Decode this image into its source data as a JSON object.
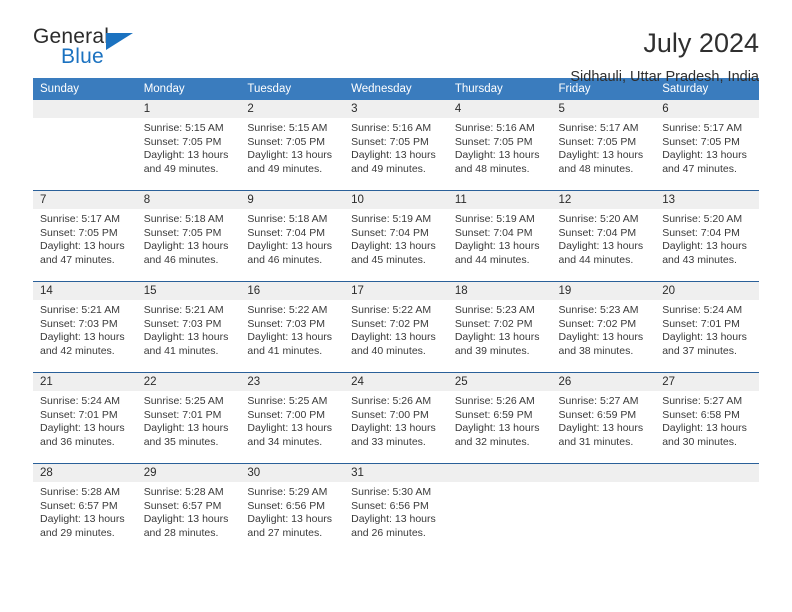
{
  "brand": {
    "name_top": "General",
    "name_bottom": "Blue",
    "accent_color": "#1b72c0"
  },
  "header": {
    "title": "July 2024",
    "subtitle": "Sidhauli, Uttar Pradesh, India"
  },
  "theme": {
    "header_row_bg": "#3a7cbe",
    "daynum_bg": "#efefef",
    "week_separator": "#2a6099",
    "text": "#2b2b2b"
  },
  "weekday_headers": [
    "Sunday",
    "Monday",
    "Tuesday",
    "Wednesday",
    "Thursday",
    "Friday",
    "Saturday"
  ],
  "weeks": [
    [
      {
        "day": "",
        "lines": []
      },
      {
        "day": "1",
        "lines": [
          "Sunrise: 5:15 AM",
          "Sunset: 7:05 PM",
          "Daylight: 13 hours",
          "and 49 minutes."
        ]
      },
      {
        "day": "2",
        "lines": [
          "Sunrise: 5:15 AM",
          "Sunset: 7:05 PM",
          "Daylight: 13 hours",
          "and 49 minutes."
        ]
      },
      {
        "day": "3",
        "lines": [
          "Sunrise: 5:16 AM",
          "Sunset: 7:05 PM",
          "Daylight: 13 hours",
          "and 49 minutes."
        ]
      },
      {
        "day": "4",
        "lines": [
          "Sunrise: 5:16 AM",
          "Sunset: 7:05 PM",
          "Daylight: 13 hours",
          "and 48 minutes."
        ]
      },
      {
        "day": "5",
        "lines": [
          "Sunrise: 5:17 AM",
          "Sunset: 7:05 PM",
          "Daylight: 13 hours",
          "and 48 minutes."
        ]
      },
      {
        "day": "6",
        "lines": [
          "Sunrise: 5:17 AM",
          "Sunset: 7:05 PM",
          "Daylight: 13 hours",
          "and 47 minutes."
        ]
      }
    ],
    [
      {
        "day": "7",
        "lines": [
          "Sunrise: 5:17 AM",
          "Sunset: 7:05 PM",
          "Daylight: 13 hours",
          "and 47 minutes."
        ]
      },
      {
        "day": "8",
        "lines": [
          "Sunrise: 5:18 AM",
          "Sunset: 7:05 PM",
          "Daylight: 13 hours",
          "and 46 minutes."
        ]
      },
      {
        "day": "9",
        "lines": [
          "Sunrise: 5:18 AM",
          "Sunset: 7:04 PM",
          "Daylight: 13 hours",
          "and 46 minutes."
        ]
      },
      {
        "day": "10",
        "lines": [
          "Sunrise: 5:19 AM",
          "Sunset: 7:04 PM",
          "Daylight: 13 hours",
          "and 45 minutes."
        ]
      },
      {
        "day": "11",
        "lines": [
          "Sunrise: 5:19 AM",
          "Sunset: 7:04 PM",
          "Daylight: 13 hours",
          "and 44 minutes."
        ]
      },
      {
        "day": "12",
        "lines": [
          "Sunrise: 5:20 AM",
          "Sunset: 7:04 PM",
          "Daylight: 13 hours",
          "and 44 minutes."
        ]
      },
      {
        "day": "13",
        "lines": [
          "Sunrise: 5:20 AM",
          "Sunset: 7:04 PM",
          "Daylight: 13 hours",
          "and 43 minutes."
        ]
      }
    ],
    [
      {
        "day": "14",
        "lines": [
          "Sunrise: 5:21 AM",
          "Sunset: 7:03 PM",
          "Daylight: 13 hours",
          "and 42 minutes."
        ]
      },
      {
        "day": "15",
        "lines": [
          "Sunrise: 5:21 AM",
          "Sunset: 7:03 PM",
          "Daylight: 13 hours",
          "and 41 minutes."
        ]
      },
      {
        "day": "16",
        "lines": [
          "Sunrise: 5:22 AM",
          "Sunset: 7:03 PM",
          "Daylight: 13 hours",
          "and 41 minutes."
        ]
      },
      {
        "day": "17",
        "lines": [
          "Sunrise: 5:22 AM",
          "Sunset: 7:02 PM",
          "Daylight: 13 hours",
          "and 40 minutes."
        ]
      },
      {
        "day": "18",
        "lines": [
          "Sunrise: 5:23 AM",
          "Sunset: 7:02 PM",
          "Daylight: 13 hours",
          "and 39 minutes."
        ]
      },
      {
        "day": "19",
        "lines": [
          "Sunrise: 5:23 AM",
          "Sunset: 7:02 PM",
          "Daylight: 13 hours",
          "and 38 minutes."
        ]
      },
      {
        "day": "20",
        "lines": [
          "Sunrise: 5:24 AM",
          "Sunset: 7:01 PM",
          "Daylight: 13 hours",
          "and 37 minutes."
        ]
      }
    ],
    [
      {
        "day": "21",
        "lines": [
          "Sunrise: 5:24 AM",
          "Sunset: 7:01 PM",
          "Daylight: 13 hours",
          "and 36 minutes."
        ]
      },
      {
        "day": "22",
        "lines": [
          "Sunrise: 5:25 AM",
          "Sunset: 7:01 PM",
          "Daylight: 13 hours",
          "and 35 minutes."
        ]
      },
      {
        "day": "23",
        "lines": [
          "Sunrise: 5:25 AM",
          "Sunset: 7:00 PM",
          "Daylight: 13 hours",
          "and 34 minutes."
        ]
      },
      {
        "day": "24",
        "lines": [
          "Sunrise: 5:26 AM",
          "Sunset: 7:00 PM",
          "Daylight: 13 hours",
          "and 33 minutes."
        ]
      },
      {
        "day": "25",
        "lines": [
          "Sunrise: 5:26 AM",
          "Sunset: 6:59 PM",
          "Daylight: 13 hours",
          "and 32 minutes."
        ]
      },
      {
        "day": "26",
        "lines": [
          "Sunrise: 5:27 AM",
          "Sunset: 6:59 PM",
          "Daylight: 13 hours",
          "and 31 minutes."
        ]
      },
      {
        "day": "27",
        "lines": [
          "Sunrise: 5:27 AM",
          "Sunset: 6:58 PM",
          "Daylight: 13 hours",
          "and 30 minutes."
        ]
      }
    ],
    [
      {
        "day": "28",
        "lines": [
          "Sunrise: 5:28 AM",
          "Sunset: 6:57 PM",
          "Daylight: 13 hours",
          "and 29 minutes."
        ]
      },
      {
        "day": "29",
        "lines": [
          "Sunrise: 5:28 AM",
          "Sunset: 6:57 PM",
          "Daylight: 13 hours",
          "and 28 minutes."
        ]
      },
      {
        "day": "30",
        "lines": [
          "Sunrise: 5:29 AM",
          "Sunset: 6:56 PM",
          "Daylight: 13 hours",
          "and 27 minutes."
        ]
      },
      {
        "day": "31",
        "lines": [
          "Sunrise: 5:30 AM",
          "Sunset: 6:56 PM",
          "Daylight: 13 hours",
          "and 26 minutes."
        ]
      },
      {
        "day": "",
        "lines": []
      },
      {
        "day": "",
        "lines": []
      },
      {
        "day": "",
        "lines": []
      }
    ]
  ]
}
